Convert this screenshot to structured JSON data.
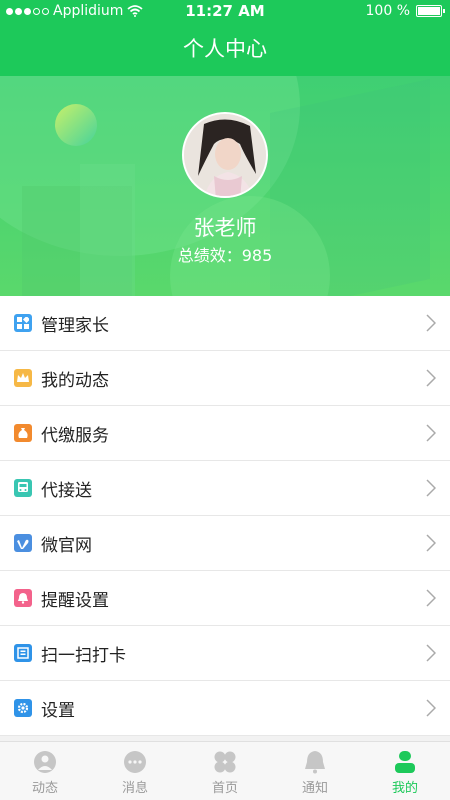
{
  "status_bar": {
    "carrier": "Applidium",
    "time": "11:27 AM",
    "battery": "100 %"
  },
  "nav": {
    "title": "个人中心"
  },
  "profile": {
    "name": "张老师",
    "score_text": "总绩效：985"
  },
  "menu": [
    {
      "label": "管理家长",
      "icon": "grid-icon",
      "color": "#3fa2f0"
    },
    {
      "label": "我的动态",
      "icon": "crown-icon",
      "color": "#f6b846"
    },
    {
      "label": "代缴服务",
      "icon": "money-bag-icon",
      "color": "#f28a2e"
    },
    {
      "label": "代接送",
      "icon": "bus-icon",
      "color": "#39c6b2"
    },
    {
      "label": "微官网",
      "icon": "vimeo-icon",
      "color": "#4b8fe0"
    },
    {
      "label": "提醒设置",
      "icon": "bell-icon",
      "color": "#f3628b"
    },
    {
      "label": "扫一扫打卡",
      "icon": "scan-icon",
      "color": "#2f93e8"
    },
    {
      "label": "设置",
      "icon": "gear-icon",
      "color": "#2f93e8"
    }
  ],
  "tabs": [
    {
      "label": "动态",
      "icon": "user-heart-icon",
      "active": false
    },
    {
      "label": "消息",
      "icon": "chat-icon",
      "active": false
    },
    {
      "label": "首页",
      "icon": "clover-icon",
      "active": false
    },
    {
      "label": "通知",
      "icon": "bell-icon",
      "active": false
    },
    {
      "label": "我的",
      "icon": "person-icon",
      "active": true
    }
  ],
  "colors": {
    "brand": "#1dc95a",
    "tab_inactive": "#9a9a9a"
  }
}
